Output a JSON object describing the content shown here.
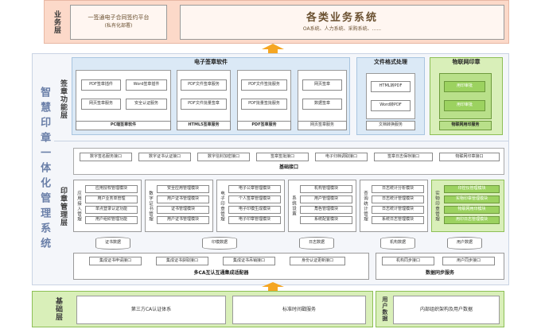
{
  "layers": {
    "business": "业务层",
    "signing": "签章功能层",
    "management": "印章管理层",
    "base": "基础层",
    "user_data": "用户数据"
  },
  "sidebar_title": "智慧印章一体化管理系统",
  "business": {
    "platform_title": "一签通电子合同签约平台",
    "platform_sub": "(私有化部署)",
    "systems_title": "各类业务系统",
    "systems_sub": "OA系统、人力系统、采购系统、......"
  },
  "signing": {
    "software_title": "电子签章软件",
    "software_items": [
      "PDF签章插件",
      "Word签章插件",
      "PDF文件签章服务",
      "PDF文件签批服务",
      "网页签章",
      "网页签章服务",
      "安全认证服务",
      "PDF文件批量签章",
      "PDF批量签批服务",
      "数据签章"
    ],
    "software_bottom": [
      "PC端签章软件",
      "HTML5签章服务",
      "PDF签章服务",
      "网页签章服务"
    ],
    "format_title": "文件格式处理",
    "format_items": [
      "HTML转PDF",
      "Word转PDF"
    ],
    "format_bottom": "文档转换服务",
    "iot_title": "物联网印章",
    "iot_items": [
      "用印审批",
      "用印审批"
    ],
    "iot_bottom": "物联网用印服务"
  },
  "interfaces": {
    "items": [
      "数字签名服务接口",
      "数字证书认证接口",
      "数字信封加密接口",
      "签章签批接口",
      "电子归档调取接口",
      "签章日志保存接口",
      "物联网印章接口"
    ],
    "base": "基础接口"
  },
  "management": {
    "groups": [
      {
        "label": "应用接入管理",
        "items": [
          "应用授权管理模块",
          "用户业务单管理",
          "单点登录认证功能",
          "用户组织管理功能"
        ]
      },
      {
        "label": "数字证书管理",
        "items": [
          "安全应用管理模块",
          "用户证书管理模块",
          "证书管理模块",
          "用户证书管理模块"
        ]
      },
      {
        "label": "电子印章管理",
        "items": [
          "电子公章管理模块",
          "个人签章管理模块",
          "电子印模生成模块",
          "电子印章管理模块"
        ]
      },
      {
        "label": "系统设置",
        "items": [
          "机构管理模块",
          "用户管理模块",
          "角色管理模块",
          "系统配置模块"
        ]
      },
      {
        "label": "查询统计管理",
        "items": [
          "日志统计分析模块",
          "日志统计管理模块",
          "日志统计管理模块",
          "系统日志管理模块"
        ]
      },
      {
        "label": "实物印章管理",
        "items": [
          "印控仪管理模块",
          "实物印章管理模块",
          "物联网用印模块",
          "用印日志管理模块"
        ]
      }
    ],
    "dbs": [
      "证书数据",
      "印模数据",
      "日志数据",
      "机构数据",
      "用户数据"
    ],
    "ca_items": [
      "集成证书申请接口",
      "集成证书获取接口",
      "集成证书吊销接口",
      "身份认证更新接口"
    ],
    "ca_title": "多CA互认互通集成适配器",
    "sync_items": [
      "机构同步接口",
      "用户同步接口"
    ],
    "sync_title": "数据同步服务"
  },
  "base": {
    "items": [
      "第三方CA认证体系",
      "标准时间戳服务"
    ],
    "user_data_item": "内部组织架构及用户数据"
  },
  "colors": {
    "orange_panel": "#fcd9c9",
    "blue_panel": "#dbe9f6",
    "green_panel": "#d9efb9",
    "green_box": "#9cd260",
    "arrow": "#f5a623"
  }
}
